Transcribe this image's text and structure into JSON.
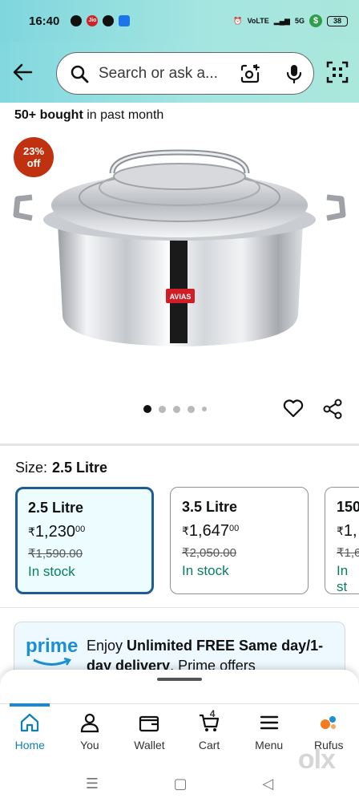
{
  "status_bar": {
    "time": "16:40",
    "network_label": "VoLTE",
    "five_g": "5G",
    "battery": "38"
  },
  "search": {
    "placeholder": "Search or ask a..."
  },
  "product": {
    "bought_bold": "50+ bought",
    "bought_rest": " in past month",
    "discount_line1": "23%",
    "discount_line2": "off",
    "brand": "AVIAS",
    "image_count": 5,
    "active_image": 1
  },
  "size": {
    "label": "Size:",
    "selected": "2.5 Litre"
  },
  "variants": [
    {
      "name": "2.5 Litre",
      "price_main": "1,230",
      "price_fraction": "00",
      "mrp": "₹1,590.00",
      "stock": "In stock",
      "selected": true
    },
    {
      "name": "3.5 Litre",
      "price_main": "1,647",
      "price_fraction": "00",
      "mrp": "₹2,050.00",
      "stock": "In stock",
      "selected": false
    },
    {
      "name": "150",
      "price_main": "1,",
      "price_fraction": "",
      "mrp": "₹1,6",
      "stock": "In st",
      "selected": false
    }
  ],
  "currency": "₹",
  "prime": {
    "logo": "prime",
    "text_pre": "Enjoy ",
    "text_bold": "Unlimited FREE Same day/1-day delivery",
    "text_post": ", Prime offers"
  },
  "tabs": [
    {
      "label": "Home",
      "icon": "home-icon"
    },
    {
      "label": "You",
      "icon": "user-icon"
    },
    {
      "label": "Wallet",
      "icon": "wallet-icon"
    },
    {
      "label": "Cart",
      "icon": "cart-icon",
      "count": "4"
    },
    {
      "label": "Menu",
      "icon": "menu-icon"
    },
    {
      "label": "Rufus",
      "icon": "rufus-icon"
    }
  ],
  "watermark": "olx",
  "colors": {
    "accent": "#1f5c93",
    "stock_green": "#067d62",
    "discount": "#c0310f",
    "prime_blue": "#1a8fd6",
    "active_tab": "#117eb4"
  }
}
